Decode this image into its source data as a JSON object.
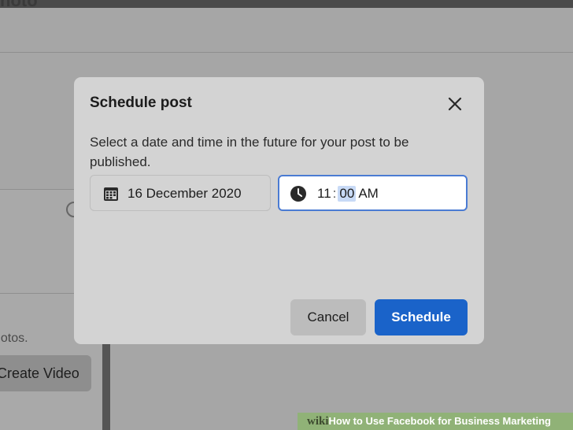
{
  "background": {
    "page_title": "hoto",
    "hint_text": "hotos.",
    "create_button_label": "Create Video"
  },
  "modal": {
    "title": "Schedule post",
    "description": "Select a date and time in the future for your post to be published.",
    "date": {
      "icon": "calendar-icon",
      "value": "16 December 2020"
    },
    "time": {
      "icon": "clock-icon",
      "hour": "11",
      "separator": ":",
      "minute": "00",
      "period": "AM"
    },
    "cancel_label": "Cancel",
    "schedule_label": "Schedule",
    "close_icon": "close-icon"
  },
  "watermark": {
    "brand": "wiki",
    "text": "How to Use Facebook for Business Marketing"
  },
  "colors": {
    "primary": "#1a63c9",
    "highlight": "#20e020"
  }
}
